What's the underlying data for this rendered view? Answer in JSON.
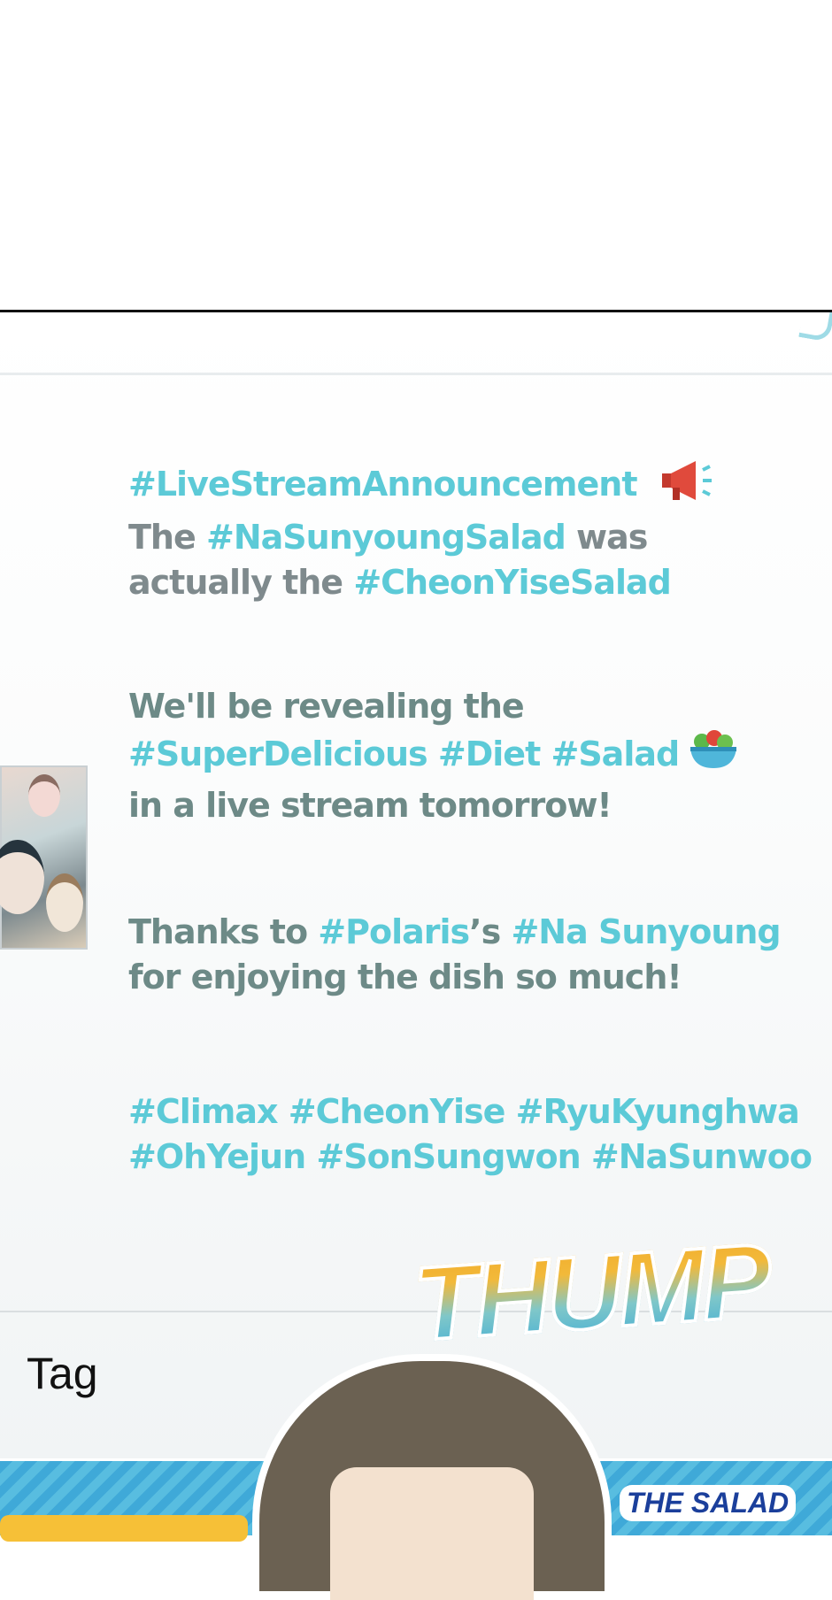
{
  "post": {
    "line1": [
      {
        "t": "#LiveStreamAnnouncement",
        "c": "hash"
      }
    ],
    "line2": [
      {
        "t": "The ",
        "c": "plain"
      },
      {
        "t": "#NaSunyoungSalad",
        "c": "hash"
      },
      {
        "t": " was",
        "c": "plain"
      }
    ],
    "line3": [
      {
        "t": "actually the ",
        "c": "plain"
      },
      {
        "t": "#CheonYiseSalad",
        "c": "hash"
      }
    ],
    "p2_line1": "We'll be revealing the",
    "p2_line2": "#SuperDelicious #Diet #Salad",
    "p2_line3": "in a live stream tomorrow!",
    "p3_line1": [
      {
        "t": "Thanks to ",
        "c": "plain2"
      },
      {
        "t": "#Polaris",
        "c": "hash"
      },
      {
        "t": "’s ",
        "c": "plain2"
      },
      {
        "t": "#Na Sunyoung",
        "c": "hash"
      }
    ],
    "p3_line2": "for enjoying the dish so much!",
    "p4_line1": "#Climax #CheonYise #RyuKyunghwa",
    "p4_line2": "#OhYejun #SonSungwon #NaSunwoo"
  },
  "icons": {
    "announcement": "megaphone-icon",
    "salad": "salad-bowl-icon"
  },
  "tag": {
    "label": "Tag"
  },
  "sfx": {
    "text": "THUMP"
  },
  "bubble": {
    "text": "THE SALAD"
  },
  "colors": {
    "hashtag": "#5ccad7",
    "text_gray": "#7f8a8d",
    "text_teal_gray": "#6d8a87",
    "sfx_orange": "#f4a623",
    "sfx_blue": "#2ea5d9"
  }
}
